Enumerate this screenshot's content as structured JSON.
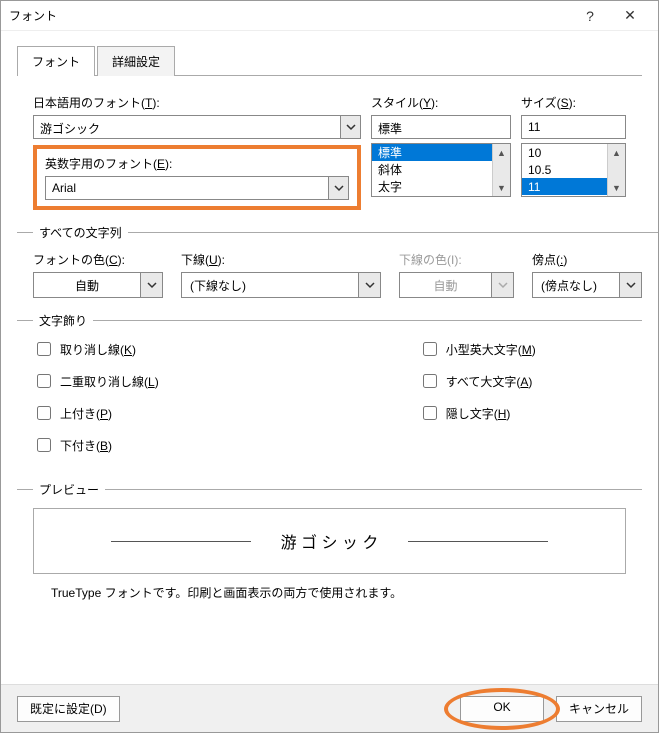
{
  "titlebar": {
    "title": "フォント"
  },
  "tabs": {
    "font": "フォント",
    "advanced": "詳細設定"
  },
  "labels": {
    "jp_font": "日本語用のフォント(",
    "jp_font_key": "T",
    "close_paren": "):",
    "latin_font": "英数字用のフォント(",
    "latin_font_key": "E",
    "style": "スタイル(",
    "style_key": "Y",
    "size": "サイズ(",
    "size_key": "S"
  },
  "values": {
    "jp_font": "游ゴシック",
    "latin_font": "Arial",
    "style": "標準",
    "size": "11"
  },
  "style_list": {
    "items": [
      "標準",
      "斜体",
      "太字"
    ],
    "selected": 0
  },
  "size_list": {
    "items": [
      "10",
      "10.5",
      "11"
    ],
    "selected": 2
  },
  "all_text_legend": "すべての文字列",
  "controls": {
    "font_color_label": "フォントの色(",
    "font_color_key": "C",
    "font_color_val": "自動",
    "underline_label": "下線(",
    "underline_key": "U",
    "underline_val": "(下線なし)",
    "underline_color_label": "下線の色(I):",
    "underline_color_val": "自動",
    "emphasis_label": "傍点(",
    "emphasis_key": ":",
    "emphasis_val": "(傍点なし)"
  },
  "decoration_legend": "文字飾り",
  "checks": {
    "strike": "取り消し線(",
    "strike_key": "K",
    "dbl_strike": "二重取り消し線(",
    "dbl_strike_key": "L",
    "super": "上付き(",
    "super_key": "P",
    "sub": "下付き(",
    "sub_key": "B",
    "smallcaps": "小型英大文字(",
    "smallcaps_key": "M",
    "allcaps": "すべて大文字(",
    "allcaps_key": "A",
    "hidden": "隠し文字(",
    "hidden_key": "H"
  },
  "preview": {
    "legend": "プレビュー",
    "sample": "游 ゴ シ ッ ク",
    "note": "TrueType フォントです。印刷と画面表示の両方で使用されます。"
  },
  "footer": {
    "default": "既定に設定(D)",
    "ok": "OK",
    "cancel": "キャンセル"
  }
}
